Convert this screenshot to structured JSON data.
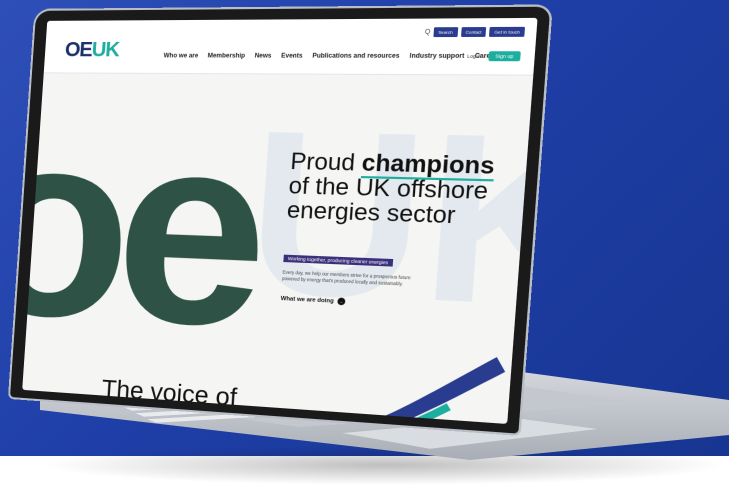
{
  "brand": {
    "logo_main": "OE",
    "logo_accent": "UK"
  },
  "nav": {
    "items": [
      "Who we are",
      "Membership",
      "News",
      "Events",
      "Publications and resources",
      "Industry support",
      "Careers"
    ],
    "utility": [
      "Q",
      "Search",
      "Contact",
      "Get in touch"
    ],
    "login": "Log in",
    "signup": "Sign up"
  },
  "hero": {
    "big_left": "oe",
    "big_right": "UK",
    "headline_pre": "Proud ",
    "headline_strong": "champions",
    "headline_post": "of the UK offshore energies sector",
    "tag": "Working together, producing cleaner energies",
    "body": "Every day, we help our members strive for a prosperous future powered by energy that's produced locally and sustainably.",
    "cta": "What we are doing",
    "cta_icon": "arrow-right-icon"
  },
  "section": {
    "voice": "The voice of"
  },
  "colors": {
    "brand_navy": "#1c2f6b",
    "brand_teal": "#1cae9f",
    "tag_purple": "#3a2f7a",
    "background_blue": "#1f3fa8"
  }
}
